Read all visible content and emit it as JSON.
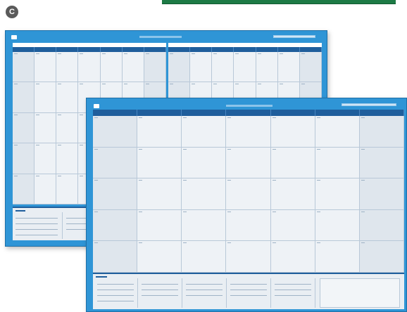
{
  "badge": {
    "letter": "C"
  },
  "colors": {
    "frame": "#2f95d6",
    "header_band": "#1f5e9c",
    "cell": "#eef2f6",
    "accent_green": "#1d7a45"
  },
  "back_planner": {
    "logo_icon": "brand-logo-icon"
  },
  "front_planner": {
    "logo_icon": "brand-logo-icon"
  }
}
